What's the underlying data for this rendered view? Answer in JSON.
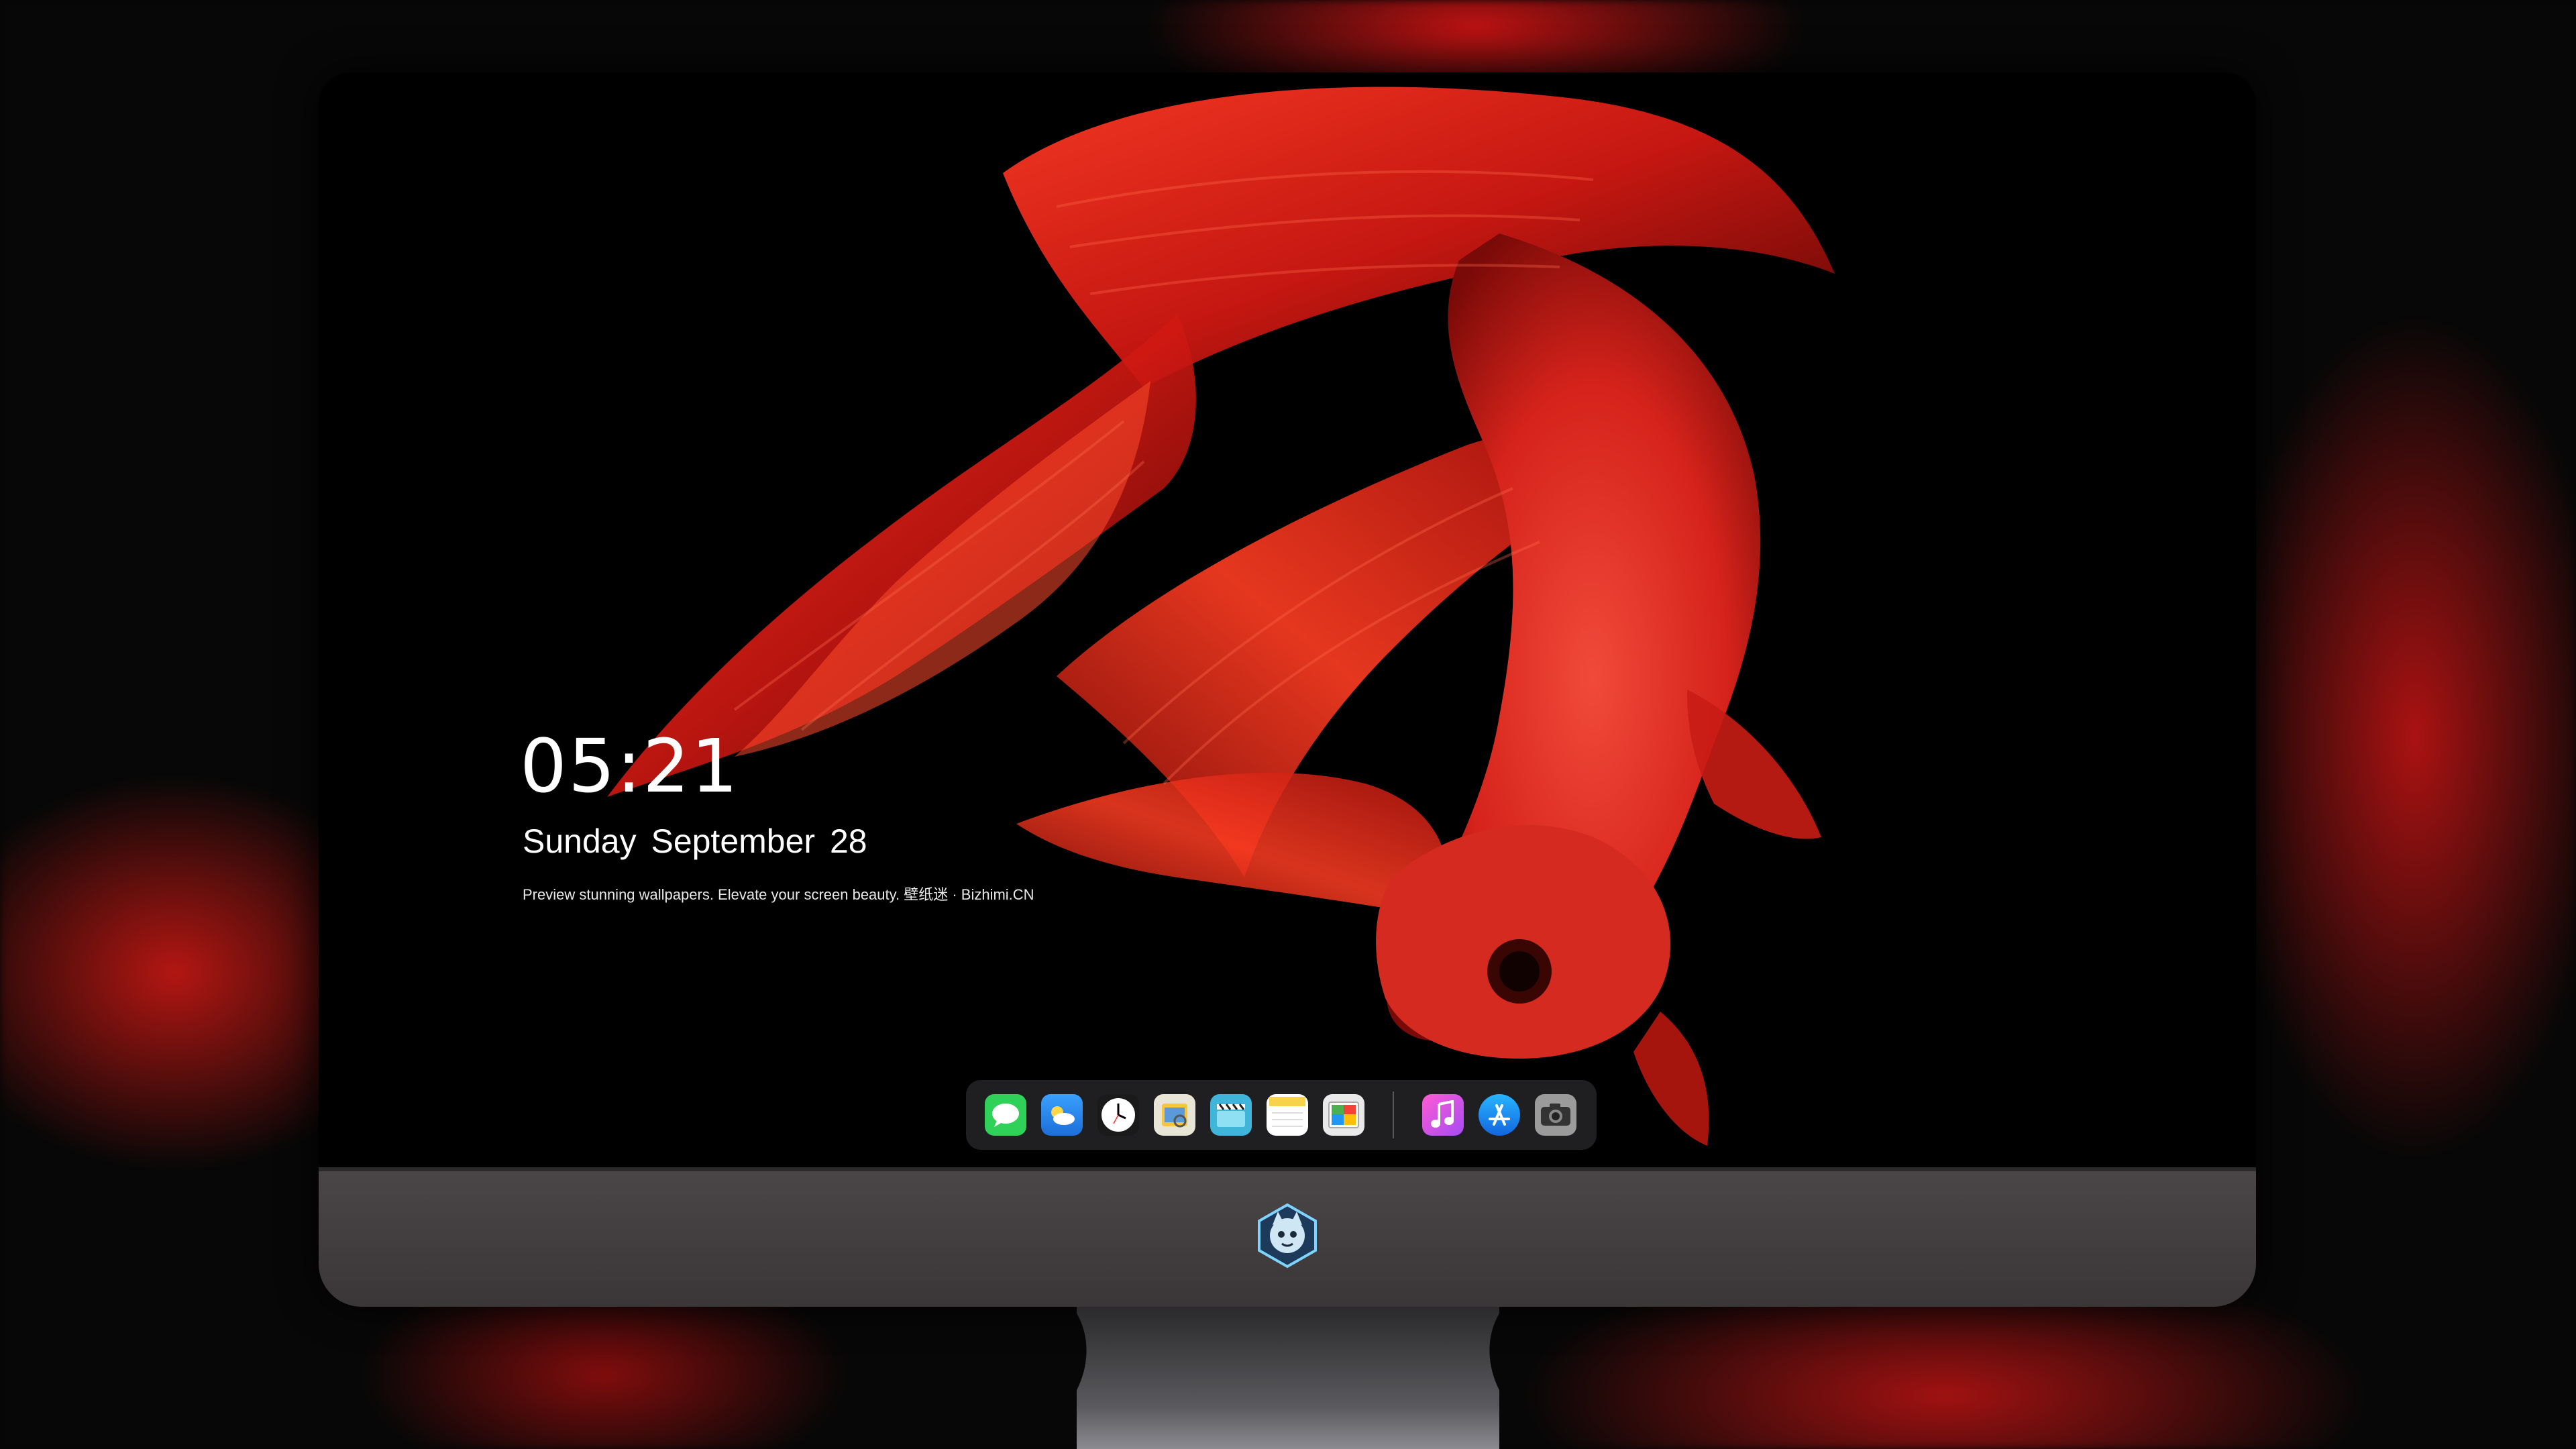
{
  "lockscreen": {
    "time": "05:21",
    "date": "Sunday September  28",
    "tagline": "Preview stunning wallpapers. Elevate your screen beauty. 壁纸迷 · Bizhimi.CN"
  },
  "dock": {
    "apps": [
      {
        "name": "messages-icon",
        "color": "#2fd158"
      },
      {
        "name": "weather-icon",
        "color": "#2b8cf0"
      },
      {
        "name": "clock-icon",
        "color": "#ffffff"
      },
      {
        "name": "preview-icon",
        "color": "#f5c542"
      },
      {
        "name": "clapperboard-icon",
        "color": "#3fb6d9"
      },
      {
        "name": "notes-icon",
        "color": "#f7d34a"
      },
      {
        "name": "photos-icon",
        "color": "#e9e9e9"
      },
      {
        "name": "music-icon",
        "color": "#d94cf0"
      },
      {
        "name": "app-store-icon",
        "color": "#1c8cf5"
      },
      {
        "name": "camera-icon",
        "color": "#8d8d8d"
      }
    ]
  },
  "colors": {
    "fish_red": "#e3241c",
    "chin_gray": "#443f42",
    "dock_bg": "#28282c"
  }
}
